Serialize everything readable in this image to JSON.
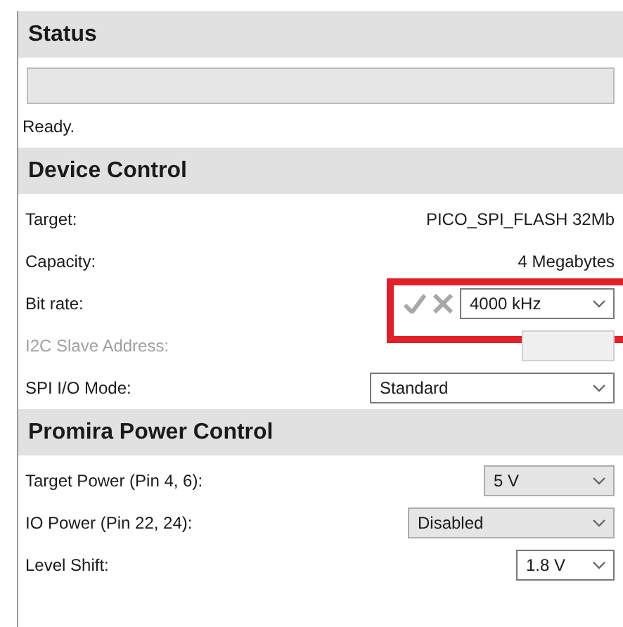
{
  "sections": [
    {
      "title": "Status",
      "progress": {
        "level": 0
      },
      "message": "Ready."
    },
    {
      "title": "Device Control",
      "rows": [
        {
          "kind": "text",
          "label": "Target:",
          "value": "PICO_SPI_FLASH 32Mb",
          "disabled": false
        },
        {
          "kind": "text",
          "label": "Capacity:",
          "value": "4 Megabytes",
          "disabled": false
        },
        {
          "kind": "combo",
          "label": "Bit rate:",
          "value": "4000 kHz",
          "disabled": false,
          "actions": true,
          "actions_disabled": true,
          "highlighted": true
        },
        {
          "kind": "field",
          "label": "I2C Slave Address:",
          "disabled": true
        },
        {
          "kind": "combo",
          "label": "SPI I/O Mode:",
          "value": "Standard",
          "disabled": false
        }
      ]
    },
    {
      "title": "Promira Power Control",
      "rows": [
        {
          "kind": "dropdown",
          "label": "Target Power (Pin 4, 6):",
          "value": "5 V",
          "disabled": false
        },
        {
          "kind": "dropdown",
          "label": "IO Power (Pin 22, 24):",
          "value": "Disabled",
          "disabled": false
        },
        {
          "kind": "combo",
          "label": "Level Shift:",
          "value": "1.8 V",
          "disabled": false
        }
      ]
    }
  ]
}
